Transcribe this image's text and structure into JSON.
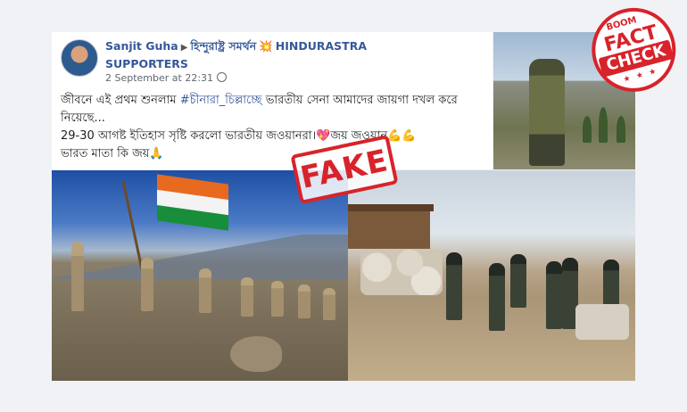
{
  "post": {
    "author": "Sanjit Guha",
    "arrow": "▶",
    "group_bengali": "হিন্দুরাষ্ট্র সমর্থন",
    "spark": "💥",
    "group_english": "HINDURASTRA SUPPORTERS",
    "timestamp": "2 September at 22:31",
    "line1_before": "জীবনে এই প্রথম শুনলাম ",
    "hashtag": "#চীনারা_চিল্লাচ্ছে",
    "line1_after": " ভারতীয় সেনা আমাদের জায়গা দখল করে নিয়েছে...",
    "line2": "29-30 আগষ্ট ইতিহাস সৃষ্টি করলো ভারতীয় জওয়ানরা।💖জয় জওয়ান💪💪",
    "line3": "ভারত মাতা কি জয়🙏"
  },
  "overlay": {
    "fake_stamp": "FAKE",
    "badge_boom": "BOOM",
    "badge_fact": "FACT",
    "badge_check": "CHECK",
    "badge_stars": "★ ★ ★"
  },
  "icons": [
    "avatar",
    "globe-icon",
    "soldier-photo",
    "flag-march-photo",
    "army-post-photo",
    "fake-stamp",
    "fact-check-badge"
  ],
  "colors": {
    "link": "#365899",
    "stamp_red": "#d8232a"
  }
}
